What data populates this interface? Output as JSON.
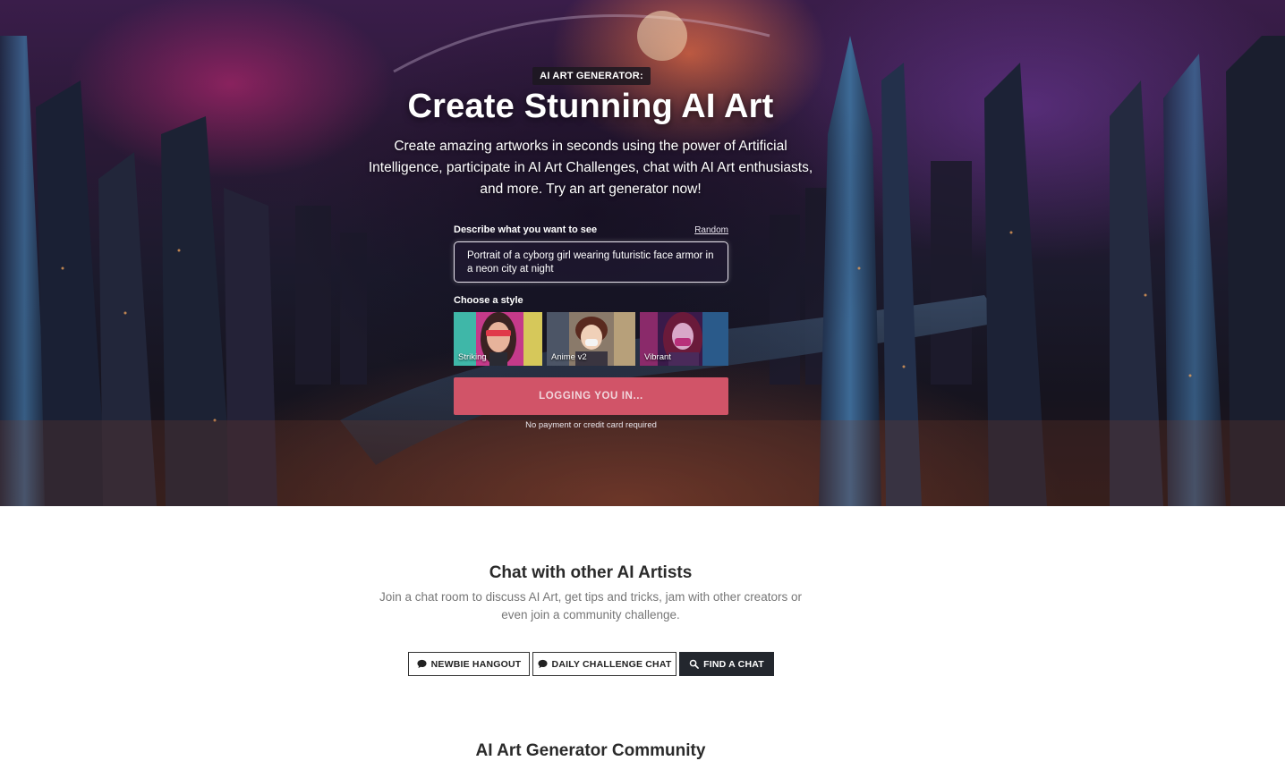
{
  "hero": {
    "badge": "AI ART GENERATOR:",
    "title": "Create Stunning AI Art",
    "description": "Create amazing artworks in seconds using the power of Artificial Intelligence, participate in AI Art Challenges, chat with AI Art enthusiasts, and more. Try an art generator now!",
    "prompt_label": "Describe what you want to see",
    "random_link": "Random",
    "prompt_value": "Portrait of a cyborg girl wearing futuristic face armor in a neon city at night",
    "style_label": "Choose a style",
    "styles": [
      {
        "label": "Striking",
        "selected": true
      },
      {
        "label": "Anime v2",
        "selected": false
      },
      {
        "label": "Vibrant",
        "selected": false
      }
    ],
    "submit_label": "LOGGING YOU IN...",
    "no_payment": "No payment or credit card required",
    "colors": {
      "button": "#d15468",
      "selected_outline": "#3f9bd8"
    }
  },
  "chat": {
    "title": "Chat with other AI Artists",
    "description": "Join a chat room to discuss AI Art, get tips and tricks, jam with other creators or even join a community challenge.",
    "buttons": [
      {
        "label": "NEWBIE HANGOUT",
        "icon": "chat-bubble-icon"
      },
      {
        "label": "DAILY CHALLENGE CHAT",
        "icon": "chat-bubble-icon"
      },
      {
        "label": "FIND A CHAT",
        "icon": "search-icon"
      }
    ]
  },
  "community": {
    "title": "AI Art Generator Community"
  }
}
